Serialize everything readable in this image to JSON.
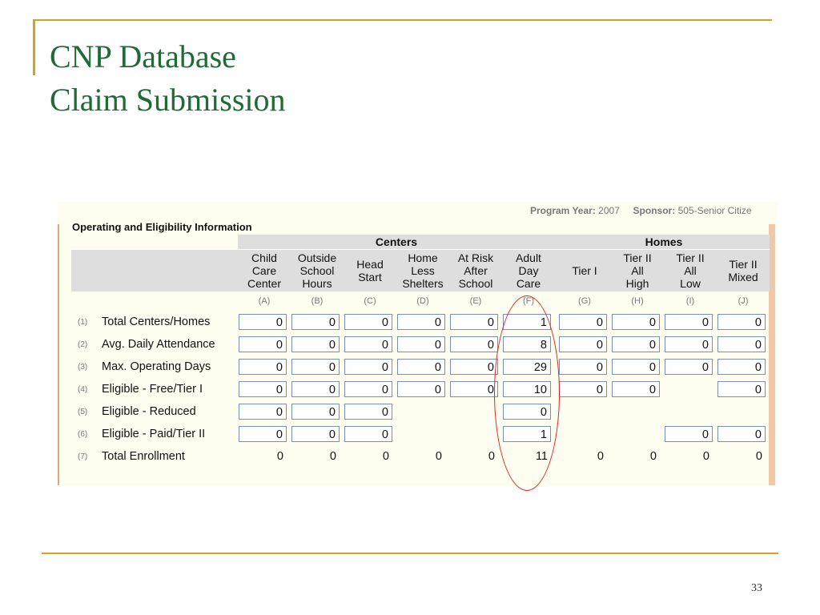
{
  "slide": {
    "title_line1": "CNP Database",
    "title_line2": "Claim Submission",
    "page_number": "33",
    "accent_color": "#d6a21f",
    "title_color": "#1f6a36"
  },
  "screenshot": {
    "program_year_label": "Program Year:",
    "program_year_value": "2007",
    "sponsor_label": "Sponsor:",
    "sponsor_value": "505-Senior Citize",
    "section_title": "Operating and Eligibility Information",
    "groups": {
      "centers": "Centers",
      "homes": "Homes"
    },
    "columns": [
      {
        "label": "Child Care Center",
        "lines": [
          "Child",
          "Care",
          "Center"
        ],
        "letter": "(A)"
      },
      {
        "label": "Outside School Hours",
        "lines": [
          "Outside",
          "School",
          "Hours"
        ],
        "letter": "(B)"
      },
      {
        "label": "Head Start",
        "lines": [
          "Head",
          "Start"
        ],
        "letter": "(C)"
      },
      {
        "label": "Home Less Shelters",
        "lines": [
          "Home",
          "Less",
          "Shelters"
        ],
        "letter": "(D)"
      },
      {
        "label": "At Risk After School",
        "lines": [
          "At Risk",
          "After",
          "School"
        ],
        "letter": "(E)"
      },
      {
        "label": "Adult Day Care",
        "lines": [
          "Adult",
          "Day",
          "Care"
        ],
        "letter": "(F)"
      },
      {
        "label": "Tier I",
        "lines": [
          "Tier I"
        ],
        "letter": "(G)"
      },
      {
        "label": "Tier II All High",
        "lines": [
          "Tier II",
          "All",
          "High"
        ],
        "letter": "(H)"
      },
      {
        "label": "Tier II All Low",
        "lines": [
          "Tier II",
          "All",
          "Low"
        ],
        "letter": "(I)"
      },
      {
        "label": "Tier II Mixed",
        "lines": [
          "Tier II",
          "Mixed"
        ],
        "letter": "(J)"
      }
    ],
    "rows": [
      {
        "num": "(1)",
        "label": "Total Centers/Homes",
        "cells": [
          {
            "v": "0",
            "t": "box"
          },
          {
            "v": "0",
            "t": "box"
          },
          {
            "v": "0",
            "t": "box"
          },
          {
            "v": "0",
            "t": "box"
          },
          {
            "v": "0",
            "t": "box"
          },
          {
            "v": "1",
            "t": "box"
          },
          {
            "v": "0",
            "t": "box"
          },
          {
            "v": "0",
            "t": "box"
          },
          {
            "v": "0",
            "t": "box"
          },
          {
            "v": "0",
            "t": "box"
          }
        ]
      },
      {
        "num": "(2)",
        "label": "Avg. Daily Attendance",
        "cells": [
          {
            "v": "0",
            "t": "box"
          },
          {
            "v": "0",
            "t": "box"
          },
          {
            "v": "0",
            "t": "box"
          },
          {
            "v": "0",
            "t": "box"
          },
          {
            "v": "0",
            "t": "box"
          },
          {
            "v": "8",
            "t": "box"
          },
          {
            "v": "0",
            "t": "box"
          },
          {
            "v": "0",
            "t": "box"
          },
          {
            "v": "0",
            "t": "box"
          },
          {
            "v": "0",
            "t": "box"
          }
        ]
      },
      {
        "num": "(3)",
        "label": "Max. Operating Days",
        "cells": [
          {
            "v": "0",
            "t": "box"
          },
          {
            "v": "0",
            "t": "box"
          },
          {
            "v": "0",
            "t": "box"
          },
          {
            "v": "0",
            "t": "box"
          },
          {
            "v": "0",
            "t": "box"
          },
          {
            "v": "29",
            "t": "box"
          },
          {
            "v": "0",
            "t": "box"
          },
          {
            "v": "0",
            "t": "box"
          },
          {
            "v": "0",
            "t": "box"
          },
          {
            "v": "0",
            "t": "box"
          }
        ]
      },
      {
        "num": "(4)",
        "label": "Eligible - Free/Tier I",
        "cells": [
          {
            "v": "0",
            "t": "box"
          },
          {
            "v": "0",
            "t": "box"
          },
          {
            "v": "0",
            "t": "box"
          },
          {
            "v": "0",
            "t": "box"
          },
          {
            "v": "0",
            "t": "box"
          },
          {
            "v": "10",
            "t": "box"
          },
          {
            "v": "0",
            "t": "box"
          },
          {
            "v": "0",
            "t": "box"
          },
          {
            "v": "",
            "t": "empty"
          },
          {
            "v": "0",
            "t": "box"
          }
        ]
      },
      {
        "num": "(5)",
        "label": "Eligible - Reduced",
        "cells": [
          {
            "v": "0",
            "t": "box"
          },
          {
            "v": "0",
            "t": "box"
          },
          {
            "v": "0",
            "t": "box"
          },
          {
            "v": "",
            "t": "empty"
          },
          {
            "v": "",
            "t": "empty"
          },
          {
            "v": "0",
            "t": "box"
          },
          {
            "v": "",
            "t": "empty"
          },
          {
            "v": "",
            "t": "empty"
          },
          {
            "v": "",
            "t": "empty"
          },
          {
            "v": "",
            "t": "empty"
          }
        ]
      },
      {
        "num": "(6)",
        "label": "Eligible - Paid/Tier II",
        "cells": [
          {
            "v": "0",
            "t": "box"
          },
          {
            "v": "0",
            "t": "box"
          },
          {
            "v": "0",
            "t": "box"
          },
          {
            "v": "",
            "t": "empty"
          },
          {
            "v": "",
            "t": "empty"
          },
          {
            "v": "1",
            "t": "box"
          },
          {
            "v": "",
            "t": "empty"
          },
          {
            "v": "",
            "t": "empty"
          },
          {
            "v": "0",
            "t": "box"
          },
          {
            "v": "0",
            "t": "box"
          }
        ]
      },
      {
        "num": "(7)",
        "label": "Total Enrollment",
        "cells": [
          {
            "v": "0",
            "t": "text"
          },
          {
            "v": "0",
            "t": "text"
          },
          {
            "v": "0",
            "t": "text"
          },
          {
            "v": "0",
            "t": "text"
          },
          {
            "v": "0",
            "t": "text"
          },
          {
            "v": "11",
            "t": "text"
          },
          {
            "v": "0",
            "t": "text"
          },
          {
            "v": "0",
            "t": "text"
          },
          {
            "v": "0",
            "t": "text"
          },
          {
            "v": "0",
            "t": "text"
          }
        ]
      }
    ],
    "highlight_color": "#d8282a"
  }
}
